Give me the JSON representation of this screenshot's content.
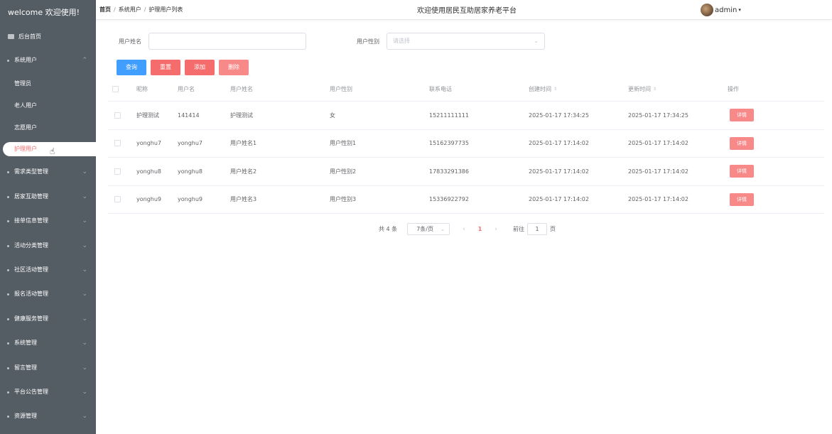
{
  "sidebar": {
    "title": "welcome 欢迎使用!",
    "home": "后台首页",
    "group_open": "系统用户",
    "sub_items": [
      "管理员",
      "老人用户",
      "志愿用户",
      "护理用户"
    ],
    "active_sub": "护理用户",
    "groups": [
      "需求类型管理",
      "居家互助管理",
      "接单信息管理",
      "活动分类管理",
      "社区活动管理",
      "报名活动管理",
      "健康服务管理",
      "系统管理",
      "留言管理",
      "平台公告管理",
      "资源管理"
    ]
  },
  "topbar": {
    "breadcrumb": [
      "首页",
      "系统用户",
      "护理用户列表"
    ],
    "site_title": "欢迎使用居民互助居家养老平台",
    "username": "admin"
  },
  "search": {
    "name_label": "用户姓名",
    "name_value": "",
    "gender_label": "用户性别",
    "gender_placeholder": "请选择"
  },
  "buttons": {
    "query": "查询",
    "reset": "重置",
    "add": "添加",
    "delete": "删除"
  },
  "table": {
    "headers": [
      "昵称",
      "用户名",
      "用户姓名",
      "用户性别",
      "联系电话",
      "创建时间",
      "更新时间",
      "操作"
    ],
    "rows": [
      {
        "nickname": "护理测试",
        "username": "141414",
        "realname": "护理测试",
        "gender": "女",
        "phone": "15211111111",
        "created": "2025-01-17 17:34:25",
        "updated": "2025-01-17 17:34:25",
        "action": "详情"
      },
      {
        "nickname": "yonghu7",
        "username": "yonghu7",
        "realname": "用户姓名1",
        "gender": "用户性别1",
        "phone": "15162397735",
        "created": "2025-01-17 17:14:02",
        "updated": "2025-01-17 17:14:02",
        "action": "详情"
      },
      {
        "nickname": "yonghu8",
        "username": "yonghu8",
        "realname": "用户姓名2",
        "gender": "用户性别2",
        "phone": "17833291386",
        "created": "2025-01-17 17:14:02",
        "updated": "2025-01-17 17:14:02",
        "action": "详情"
      },
      {
        "nickname": "yonghu9",
        "username": "yonghu9",
        "realname": "用户姓名3",
        "gender": "用户性别3",
        "phone": "15336922792",
        "created": "2025-01-17 17:14:02",
        "updated": "2025-01-17 17:14:02",
        "action": "详情"
      }
    ]
  },
  "pagination": {
    "total": "共 4 条",
    "page_size": "7条/页",
    "current_page": "1",
    "goto_label": "前往",
    "goto_value": "1",
    "page_unit": "页"
  },
  "colors": {
    "sidebar_bg": "#545c64",
    "primary": "#409eff",
    "danger": "#f56c6c",
    "danger_light": "#f78989"
  }
}
